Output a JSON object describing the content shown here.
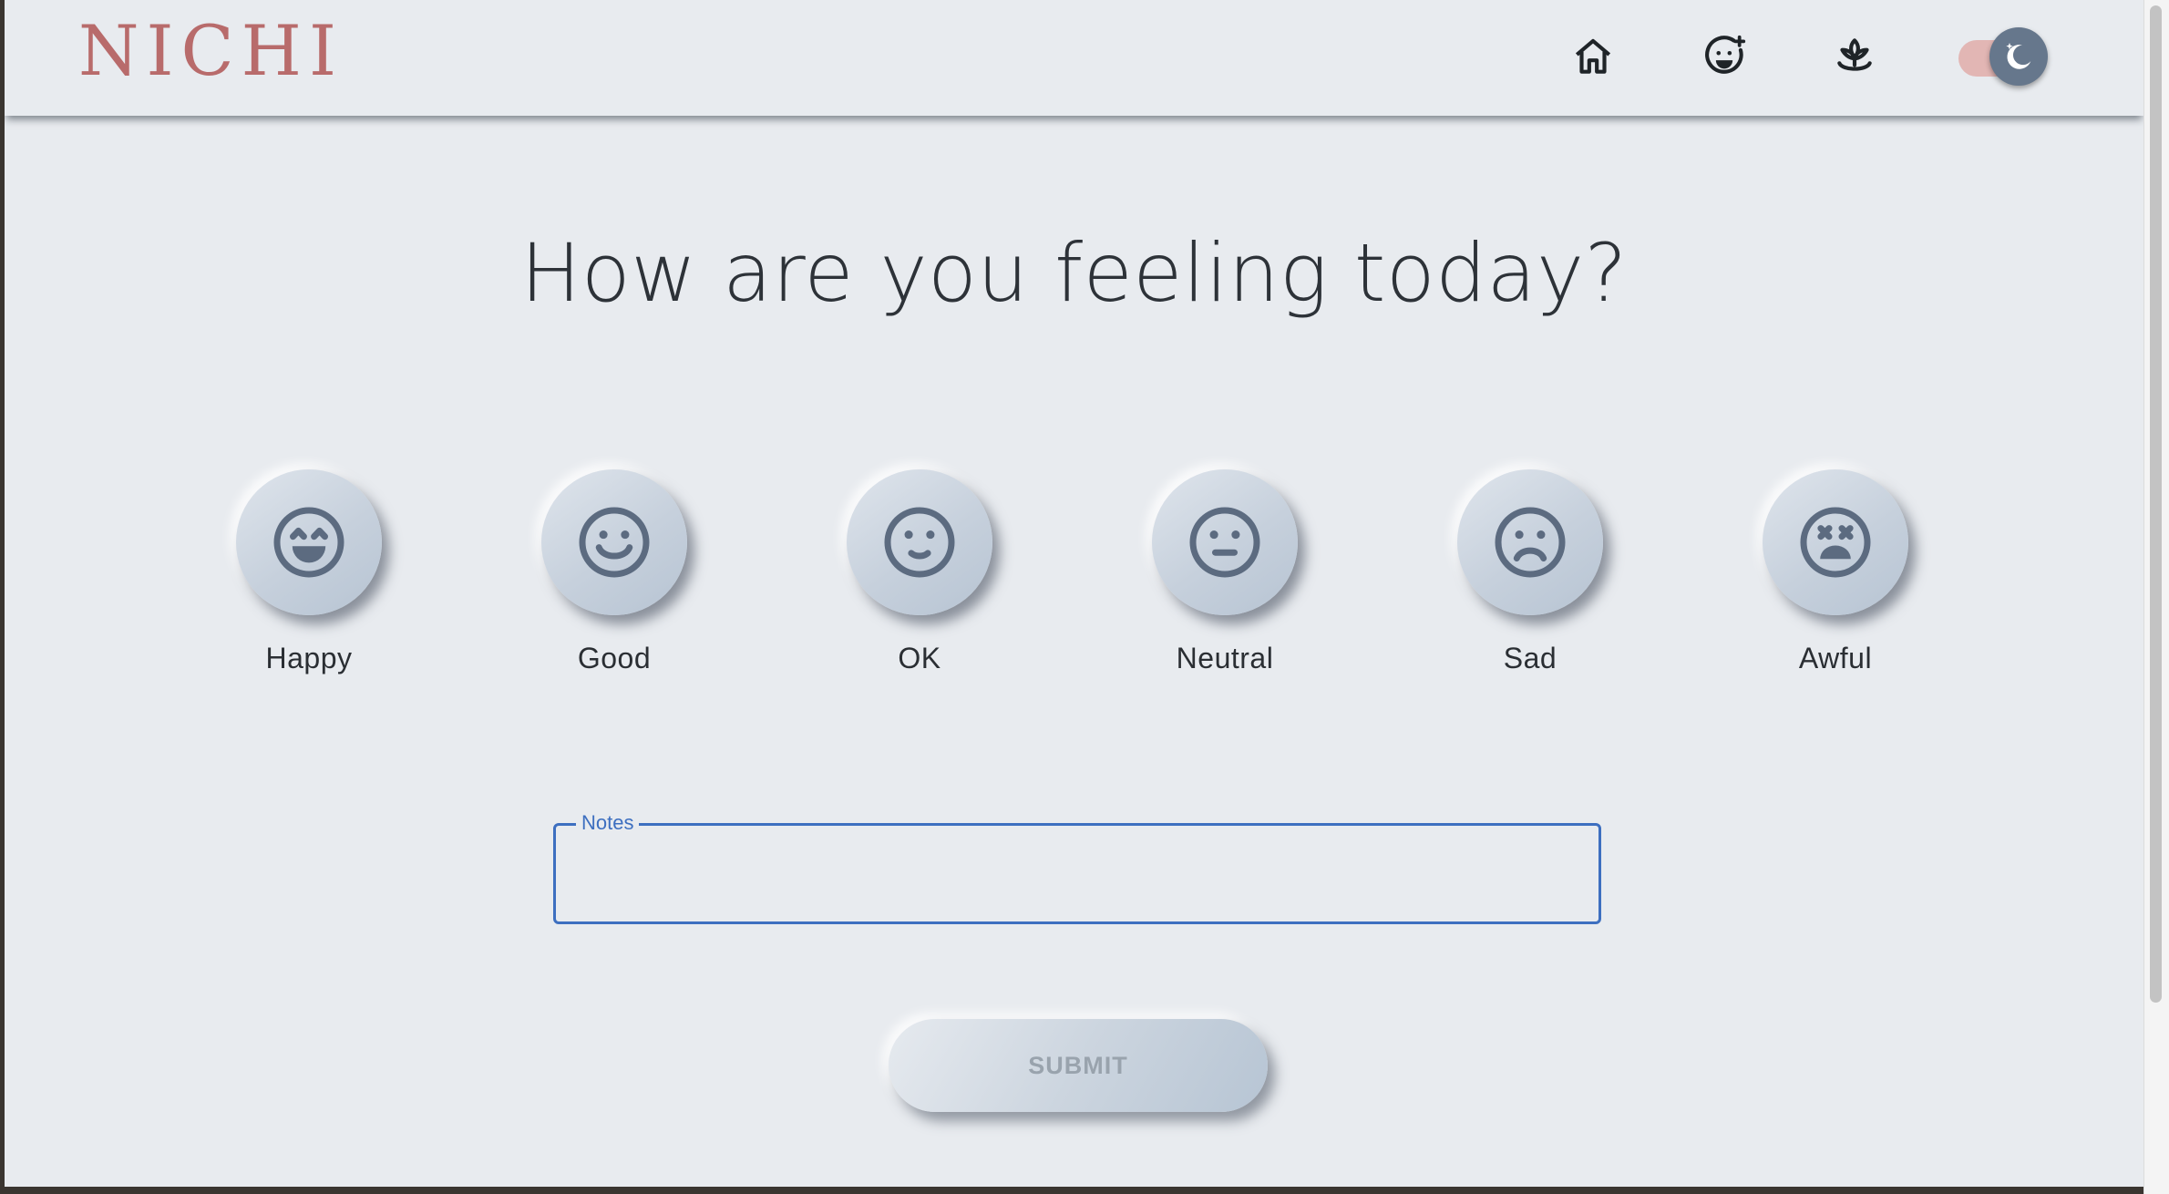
{
  "header": {
    "logo": "NICHI",
    "nav": [
      {
        "name": "home",
        "icon": "home-icon"
      },
      {
        "name": "mood",
        "icon": "mood-face-icon"
      },
      {
        "name": "wellness",
        "icon": "sprout-icon"
      }
    ],
    "theme_toggle": {
      "state": "dark",
      "icon": "moon-icon"
    }
  },
  "main": {
    "title": "How are you feeling today?",
    "moods": [
      {
        "label": "Happy",
        "icon": "face-laughing-icon"
      },
      {
        "label": "Good",
        "icon": "face-smile-icon"
      },
      {
        "label": "OK",
        "icon": "face-slight-smile-icon"
      },
      {
        "label": "Neutral",
        "icon": "face-neutral-icon"
      },
      {
        "label": "Sad",
        "icon": "face-sad-icon"
      },
      {
        "label": "Awful",
        "icon": "face-dizzy-icon"
      }
    ],
    "notes": {
      "label": "Notes",
      "value": "",
      "placeholder": ""
    },
    "submit_label": "SUBMIT"
  },
  "colors": {
    "background": "#e8ebef",
    "brand": "#b86b6b",
    "icon_stroke": "#5c6b80",
    "focus": "#3d6fc0",
    "toggle_track": "#e2b6b4",
    "toggle_knob": "#66778c"
  }
}
